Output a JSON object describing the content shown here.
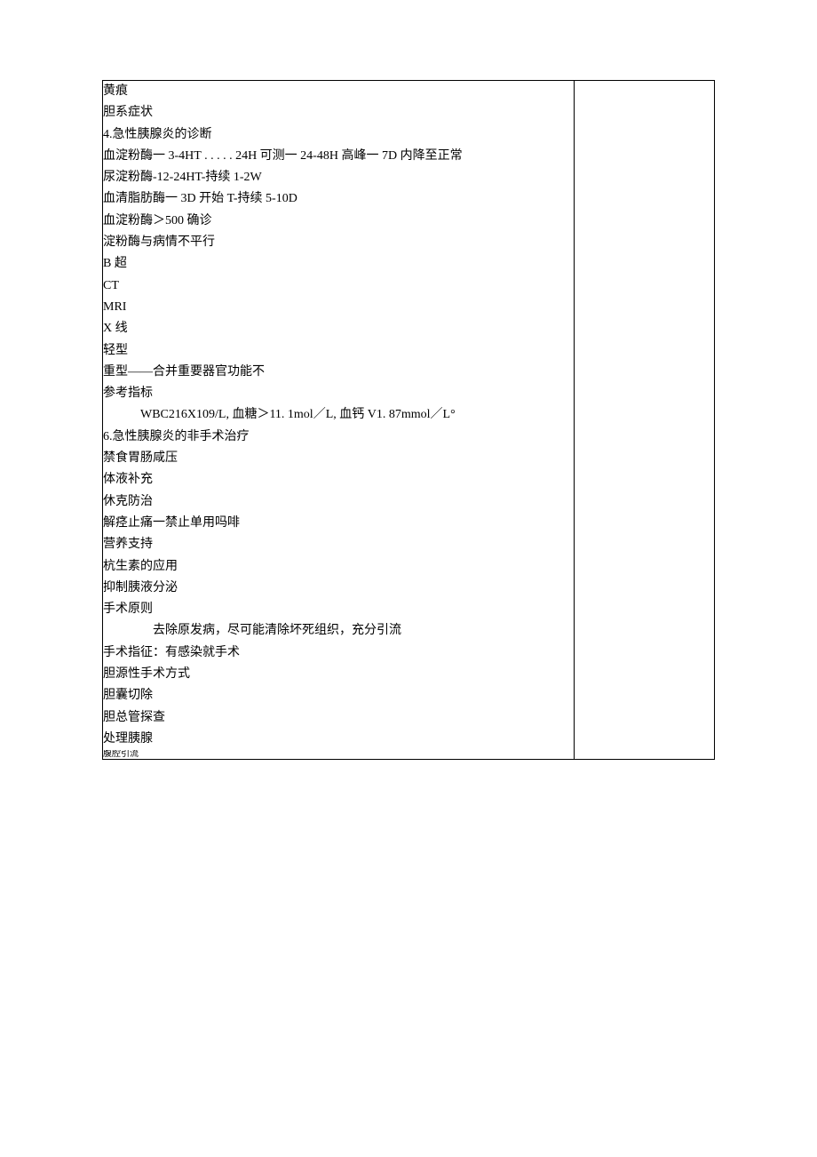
{
  "lines": [
    {
      "text": "黄痕",
      "indent": 0
    },
    {
      "text": "胆系症状",
      "indent": 0
    },
    {
      "text": "4.急性胰腺炎的诊断",
      "indent": 0
    },
    {
      "text": "血淀粉酶一 3-4HT . . . . . 24H 可测一 24-48H 高峰一 7D 内降至正常",
      "indent": 0
    },
    {
      "text": "尿淀粉酶-12-24HT-持续 1-2W",
      "indent": 0
    },
    {
      "text": "血清脂肪酶一 3D 开始 T-持续 5-10D",
      "indent": 0
    },
    {
      "text": "血淀粉酶＞500 确诊",
      "indent": 0
    },
    {
      "text": "淀粉酶与病情不平行",
      "indent": 0
    },
    {
      "text": "B 超",
      "indent": 0
    },
    {
      "text": "CT",
      "indent": 0
    },
    {
      "text": "MRI",
      "indent": 0
    },
    {
      "text": "X 线",
      "indent": 0
    },
    {
      "text": "轻型",
      "indent": 0
    },
    {
      "text": "重型——合并重要器官功能不",
      "indent": 0
    },
    {
      "text": "参考指标",
      "indent": 0
    },
    {
      "text": "WBC216X109/L, 血糖＞11. 1mol／L, 血钙 V1. 87mmol／L°",
      "indent": 1
    },
    {
      "text": "6.急性胰腺炎的非手术治疗",
      "indent": 0
    },
    {
      "text": "禁食胃肠咸压",
      "indent": 0
    },
    {
      "text": "体液补充",
      "indent": 0
    },
    {
      "text": "休克防治",
      "indent": 0
    },
    {
      "text": "解痉止痛一禁止单用吗啡",
      "indent": 0
    },
    {
      "text": "营养支持",
      "indent": 0
    },
    {
      "text": "杭生素的应用",
      "indent": 0
    },
    {
      "text": "抑制胰液分泌",
      "indent": 0
    },
    {
      "text": "手术原则",
      "indent": 0
    },
    {
      "text": "去除原发病，尽可能清除坏死组织，充分引流",
      "indent": 2
    },
    {
      "text": "手术指征：有感染就手术",
      "indent": 0
    },
    {
      "text": "胆源性手术方式",
      "indent": 0
    },
    {
      "text": "胆囊切除",
      "indent": 0
    },
    {
      "text": "胆总管探查",
      "indent": 0
    },
    {
      "text": "处理胰腺",
      "indent": 0
    }
  ],
  "lastLine": "腹腔引流"
}
